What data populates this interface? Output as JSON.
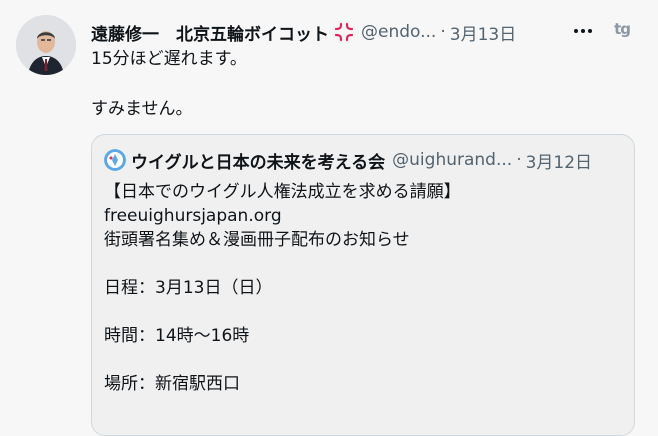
{
  "tweet": {
    "author_name": "遠藤修一　北京五輪ボイコット",
    "author_badge_icon": "anger-icon",
    "handle": "@endo...",
    "separator": "·",
    "time": "3月13日",
    "more_icon": "more-dots-icon",
    "app_badge": "tg",
    "text": "15分ほど遅れます。\n\nすみません。"
  },
  "quote": {
    "author_name": "ウイグルと日本の未来を考える会",
    "handle": "@uighurand...",
    "separator": "·",
    "time": "3月12日",
    "text": "【日本でのウイグル人権法成立を求める請願】\nfreeuighursjapan.org\n街頭署名集め＆漫画冊子配布のお知らせ\n\n日程：3月13日（日）\n\n時間：14時〜16時\n\n場所：新宿駅西口"
  },
  "colors": {
    "background": "#f7f7f7",
    "secondary_text": "#536471",
    "quote_border": "#cfd9de",
    "badge_red": "#e0245e"
  }
}
